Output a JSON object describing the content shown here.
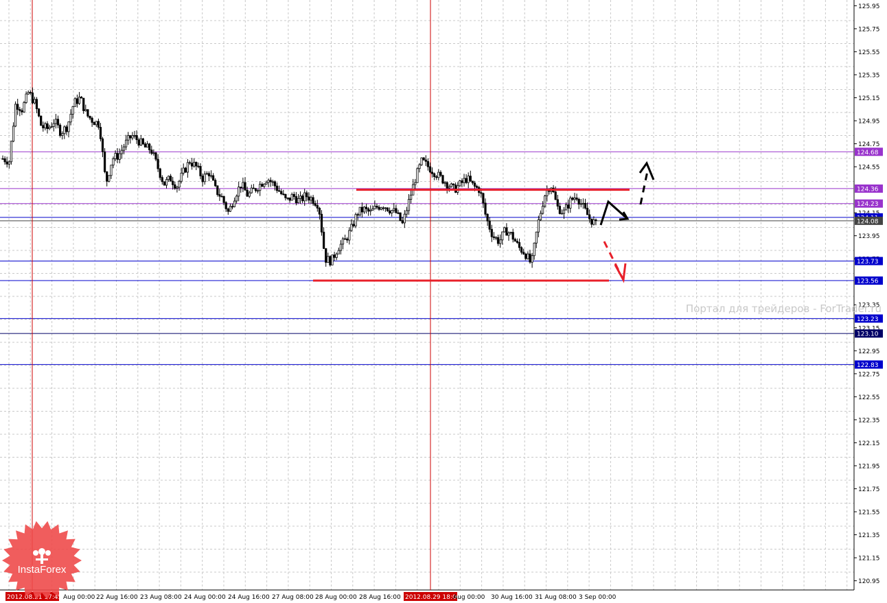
{
  "watermark": "Портал для трейдеров - ForTrader.ru",
  "logo": {
    "text": "InstaForex",
    "color": "#ee4b4b"
  },
  "chart_data": {
    "type": "candlestick",
    "instrument_note": "",
    "y_range": [
      120.87,
      126.0
    ],
    "y_ticks": [
      125.95,
      125.75,
      125.55,
      125.35,
      125.15,
      124.95,
      124.75,
      124.55,
      124.15,
      123.95,
      123.75,
      123.35,
      123.15,
      122.95,
      122.75,
      122.55,
      122.35,
      122.15,
      121.95,
      121.75,
      121.55,
      121.35,
      121.15,
      120.95
    ],
    "x_labels": [
      "2012.08.21 17:45",
      "Aug 00:00",
      "22 Aug 16:00",
      "23 Aug 08:00",
      "24 Aug 00:00",
      "24 Aug 16:00",
      "27 Aug 08:00",
      "28 Aug 00:00",
      "28 Aug 16:00",
      "2012.08.29 18:00",
      "Aug 00:00",
      "30 Aug 16:00",
      "31 Aug 08:00",
      "3 Sep 00:00"
    ],
    "x_label_positions_note": "",
    "vertical_markers": [
      {
        "label": "2012.08.21 17:45",
        "color": "#cc0000"
      },
      {
        "label": "2012.08.29 18:00",
        "color": "#cc0000"
      }
    ],
    "horizontal_levels": [
      {
        "value": 124.68,
        "label": "124.68",
        "color": "#9933cc"
      },
      {
        "value": 124.36,
        "label": "124.36",
        "color": "#9933cc"
      },
      {
        "value": 124.23,
        "label": "124.23",
        "color": "#9933cc"
      },
      {
        "value": 124.11,
        "label": "124.11",
        "color": "#0000cc"
      },
      {
        "value": 124.08,
        "label": "124.08",
        "color": "#444444"
      },
      {
        "value": 123.73,
        "label": "123.73",
        "color": "#0000cc"
      },
      {
        "value": 123.56,
        "label": "123.56",
        "color": "#0000cc"
      },
      {
        "value": 123.23,
        "label": "123.23",
        "color": "#0000cc"
      },
      {
        "value": 123.1,
        "label": "123.10",
        "color": "#000066"
      },
      {
        "value": 122.83,
        "label": "122.83",
        "color": "#0000cc"
      }
    ],
    "range_lines": [
      {
        "value": 124.35,
        "color": "#e8202a"
      },
      {
        "value": 123.56,
        "color": "#e8202a"
      }
    ],
    "close_path": [
      124.62,
      124.6,
      125.1,
      125.05,
      125.2,
      125.1,
      124.9,
      124.88,
      124.95,
      124.85,
      124.9,
      125.1,
      125.15,
      125.0,
      124.95,
      124.92,
      124.4,
      124.62,
      124.65,
      124.75,
      124.82,
      124.78,
      124.72,
      124.7,
      124.55,
      124.4,
      124.45,
      124.38,
      124.5,
      124.6,
      124.55,
      124.45,
      124.5,
      124.35,
      124.28,
      124.15,
      124.3,
      124.4,
      124.3,
      124.35,
      124.4,
      124.45,
      124.4,
      124.33,
      124.25,
      124.3,
      124.25,
      124.3,
      124.27,
      124.22,
      123.75,
      123.73,
      123.85,
      123.9,
      124.0,
      124.15,
      124.18,
      124.15,
      124.2,
      124.22,
      124.18,
      124.15,
      124.05,
      124.25,
      124.45,
      124.6,
      124.55,
      124.5,
      124.45,
      124.4,
      124.35,
      124.4,
      124.45,
      124.38,
      124.35,
      124.1,
      123.95,
      123.9,
      124.0,
      123.95,
      123.85,
      123.8,
      123.7,
      124.05,
      124.3,
      124.4,
      124.2,
      124.15,
      124.25,
      124.3,
      124.2,
      124.1,
      124.05
    ],
    "annotations": [
      {
        "type": "arrow",
        "style": "solid",
        "color": "#000000",
        "points": [
          [
            124.08,
            0
          ],
          [
            124.25,
            1
          ],
          [
            124.1,
            2
          ]
        ]
      },
      {
        "type": "arrow",
        "style": "dashed",
        "color": "#000000",
        "points": [
          [
            124.25,
            0
          ],
          [
            124.6,
            1
          ]
        ]
      },
      {
        "type": "arrow",
        "style": "dashed",
        "color": "#e8202a",
        "points": [
          [
            123.95,
            0
          ],
          [
            123.58,
            1
          ]
        ]
      }
    ]
  }
}
